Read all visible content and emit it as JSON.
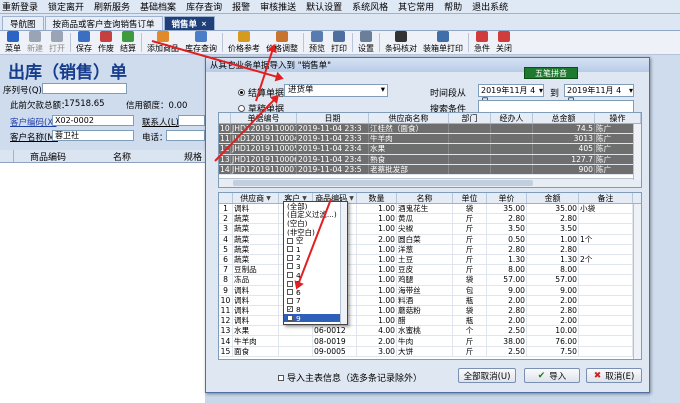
{
  "menu": [
    "重新登录",
    "锁定离开",
    "刷新服务",
    "基础档案",
    "库存查询",
    "报警",
    "审核推送",
    "默认设置",
    "系统风格",
    "其它常用",
    "帮助",
    "退出系统"
  ],
  "tabs": [
    {
      "label": "导航图",
      "active": false
    },
    {
      "label": "按商品或客户查询销售订单",
      "active": false
    },
    {
      "label": "销售单",
      "active": true
    }
  ],
  "toolbar": [
    {
      "label": "菜单",
      "icon": "menu-icon",
      "color": "#2b64c4",
      "enabled": true
    },
    {
      "label": "新建",
      "icon": "new-icon",
      "color": "#9aa4b4",
      "enabled": false
    },
    {
      "label": "打开",
      "icon": "open-icon",
      "color": "#9aa4b4",
      "enabled": false
    },
    {
      "label": "保存",
      "icon": "save-icon",
      "color": "#3b6fc2",
      "enabled": true
    },
    {
      "label": "作废",
      "icon": "void-icon",
      "color": "#c74040",
      "enabled": true
    },
    {
      "label": "结算",
      "icon": "settle-icon",
      "color": "#3d9a3d",
      "enabled": true
    },
    {
      "label": "添加商品",
      "icon": "add-goods-icon",
      "color": "#e08a2a",
      "enabled": true
    },
    {
      "label": "库存查询",
      "icon": "stock-query-icon",
      "color": "#4a7dc9",
      "enabled": true
    },
    {
      "label": "价格参考",
      "icon": "price-ref-icon",
      "color": "#d69a1f",
      "enabled": true
    },
    {
      "label": "价格调整",
      "icon": "price-adjust-icon",
      "color": "#c9742e",
      "enabled": true
    },
    {
      "label": "预览",
      "icon": "preview-icon",
      "color": "#5a7bb0",
      "enabled": true
    },
    {
      "label": "打印",
      "icon": "print-icon",
      "color": "#4e6f9e",
      "enabled": true
    },
    {
      "label": "设置",
      "icon": "settings-icon",
      "color": "#6b7f99",
      "enabled": true
    },
    {
      "label": "条码核对",
      "icon": "barcode-icon",
      "color": "#333333",
      "enabled": true
    },
    {
      "label": "装箱单打印",
      "icon": "packing-print-icon",
      "color": "#3f6ea8",
      "enabled": true
    },
    {
      "label": "急件",
      "icon": "urgent-icon",
      "color": "#d23b3b",
      "enabled": true
    },
    {
      "label": "关闭",
      "icon": "close-icon",
      "color": "#d23b3b",
      "enabled": true
    }
  ],
  "page": {
    "title": "出库（销售）单",
    "seq_label": "序列号(Q)：",
    "overdue_label": "此前欠款总额：",
    "overdue_value": "17518.65",
    "credit_label": "信用额度：0.00",
    "customer_code_label": "客户编码(X)",
    "customer_code_value": "X02-0002",
    "contact_label": "联系人(L)",
    "customer_name_label": "客户名称(M)",
    "customer_name_value": "蓉卫社",
    "phone_label": "电话：",
    "grid_headers": [
      "商品编码",
      "名称",
      "规格"
    ]
  },
  "dialog": {
    "title": "从其它业务单据导入到 \"销售单\"",
    "badge": "五笔拼音",
    "radio_settled": "结算单据",
    "radio_draft": "草稿单据",
    "doc_type": "进货单",
    "time_label": "时间段从",
    "date_from": "2019年11月 4日",
    "to_label": "到",
    "date_to": "2019年11月 4日",
    "search_label": "搜索条件",
    "upper_headers": [
      "",
      "单据编号",
      "日期",
      "供应商名称",
      "部门",
      "经办人",
      "总金额",
      "操作"
    ],
    "upper_rows": [
      [
        "10",
        "JHD12019110003",
        "2019-11-04 23:3",
        "江桂然（面食）",
        "",
        "",
        "74.5",
        "陈广"
      ],
      [
        "11",
        "JHD12019110004",
        "2019-11-04 23:3",
        "牛羊肉",
        "",
        "",
        "3013",
        "陈广"
      ],
      [
        "12",
        "JHD12019110005",
        "2019-11-04 23:4",
        "水果",
        "",
        "",
        "405",
        "陈广"
      ],
      [
        "13",
        "JHD12019110006",
        "2019-11-04 23:4",
        "熟食",
        "",
        "",
        "127.7",
        "陈广"
      ],
      [
        "14",
        "JHD12019110007",
        "2019-11-04 23:5",
        "老蔡批发部",
        "",
        "",
        "900",
        "陈广"
      ]
    ],
    "lower_headers": [
      "",
      "供应商",
      "客户",
      "商品编码",
      "数量",
      "名称",
      "单位",
      "单价",
      "金额",
      "备注"
    ],
    "lower_rows": [
      [
        "1",
        "调料",
        "",
        "",
        "1.00",
        "酒鬼花生",
        "袋",
        "35.00",
        "35.00",
        "小袋"
      ],
      [
        "2",
        "蔬菜",
        "",
        "",
        "1.00",
        "黄瓜",
        "斤",
        "2.80",
        "2.80",
        ""
      ],
      [
        "3",
        "蔬菜",
        "",
        "",
        "1.00",
        "尖椒",
        "斤",
        "3.50",
        "3.50",
        ""
      ],
      [
        "4",
        "蔬菜",
        "",
        "",
        "2.00",
        "圆白菜",
        "斤",
        "0.50",
        "1.00",
        "1个"
      ],
      [
        "5",
        "蔬菜",
        "",
        "",
        "1.00",
        "洋葱",
        "斤",
        "2.80",
        "2.80",
        ""
      ],
      [
        "6",
        "蔬菜",
        "",
        "",
        "1.00",
        "土豆",
        "斤",
        "1.30",
        "1.30",
        "2个"
      ],
      [
        "7",
        "豆制品",
        "",
        "",
        "1.00",
        "豆皮",
        "斤",
        "8.00",
        "8.00",
        ""
      ],
      [
        "8",
        "冻品",
        "",
        "",
        "1.00",
        "鸡腿",
        "袋",
        "57.00",
        "57.00",
        ""
      ],
      [
        "9",
        "调料",
        "",
        "",
        "1.00",
        "海带丝",
        "包",
        "9.00",
        "9.00",
        ""
      ],
      [
        "10",
        "调料",
        "",
        "",
        "1.00",
        "料酒",
        "瓶",
        "2.00",
        "2.00",
        ""
      ],
      [
        "11",
        "调料",
        "",
        "",
        "1.00",
        "蘑菇粉",
        "袋",
        "2.80",
        "2.80",
        ""
      ],
      [
        "12",
        "调料",
        "",
        "03-0009",
        "1.00",
        "醋",
        "瓶",
        "2.00",
        "2.00",
        ""
      ],
      [
        "13",
        "水果",
        "",
        "06-0012",
        "4.00",
        "水蜜桃",
        "个",
        "2.50",
        "10.00",
        ""
      ],
      [
        "14",
        "牛羊肉",
        "",
        "08-0019",
        "2.00",
        "牛肉",
        "斤",
        "38.00",
        "76.00",
        ""
      ],
      [
        "15",
        "面食",
        "",
        "09-0005",
        "3.00",
        "大饼",
        "斤",
        "2.50",
        "7.50",
        ""
      ]
    ],
    "filter_options": [
      {
        "label": "(全部)",
        "checked": false
      },
      {
        "label": "(自定义过滤...)",
        "checked": false
      },
      {
        "label": "(空白)",
        "checked": false
      },
      {
        "label": "(非空白)",
        "checked": false
      },
      {
        "label": "空",
        "checked": false
      },
      {
        "label": "1",
        "checked": false
      },
      {
        "label": "2",
        "checked": false
      },
      {
        "label": "3",
        "checked": false
      },
      {
        "label": "4",
        "checked": false
      },
      {
        "label": "5",
        "checked": false
      },
      {
        "label": "6",
        "checked": false
      },
      {
        "label": "7",
        "checked": false
      },
      {
        "label": "8",
        "checked": true
      },
      {
        "label": "9",
        "checked": false
      }
    ],
    "import_main_label": "导入主表信息（选多条记录除外）",
    "btn_cancel_all": "全部取消(U)",
    "btn_import": "导入",
    "btn_cancel": "取消(E)"
  }
}
